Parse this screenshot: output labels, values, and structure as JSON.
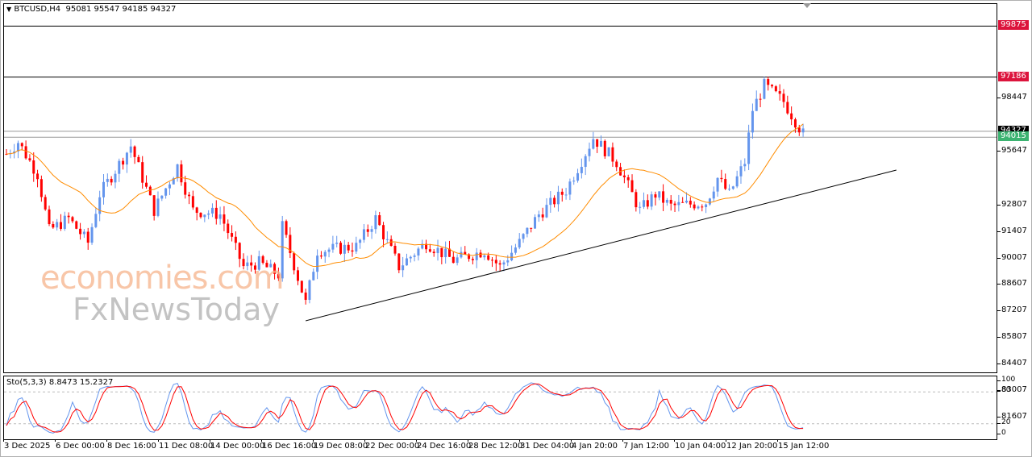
{
  "header": {
    "symbol": "BTCUSD,H4",
    "open": "95081",
    "high": "95547",
    "low": "94185",
    "close": "94327"
  },
  "indicator": {
    "label": "Sto(5,3,3)",
    "k": "8.8473",
    "d": "15.2327",
    "levels": [
      "100",
      "80",
      "20",
      "0"
    ]
  },
  "price_axis": [
    "98447",
    "95647",
    "92807",
    "91407",
    "90007",
    "88607",
    "87207",
    "85807",
    "84407",
    "83007",
    "81607"
  ],
  "price_labels": [
    {
      "value": "99875",
      "color": "#dc143c"
    },
    {
      "value": "97186",
      "color": "#dc143c"
    },
    {
      "value": "94327",
      "color": "#000000"
    },
    {
      "value": "94015",
      "color": "#3cb371"
    }
  ],
  "time_axis": [
    "3 Dec 2025",
    "6 Dec 00:00",
    "8 Dec 16:00",
    "11 Dec 08:00",
    "14 Dec 00:00",
    "16 Dec 16:00",
    "19 Dec 08:00",
    "22 Dec 00:00",
    "24 Dec 16:00",
    "28 Dec 12:00",
    "31 Dec 04:00",
    "4 Jan 20:00",
    "7 Jan 12:00",
    "10 Jan 04:00",
    "12 Jan 20:00",
    "15 Jan 12:00"
  ],
  "watermark": {
    "line1": "economies.com",
    "line2": "FxNewsToday"
  },
  "colors": {
    "bull": "#6495ed",
    "bear": "#ff0000",
    "ma": "#ff8c00",
    "k": "#6495ed",
    "d": "#ff0000"
  },
  "chart_data": {
    "type": "candlestick",
    "price_path": [
      [
        0,
        93133
      ],
      [
        3,
        93770
      ],
      [
        8,
        92070
      ],
      [
        11,
        89093
      ],
      [
        16,
        89730
      ],
      [
        21,
        88456
      ],
      [
        24,
        91006
      ],
      [
        32,
        93557
      ],
      [
        38,
        90156
      ],
      [
        44,
        92495
      ],
      [
        48,
        90156
      ],
      [
        55,
        89943
      ],
      [
        61,
        87180
      ],
      [
        65,
        87393
      ],
      [
        70,
        86755
      ],
      [
        71,
        89305
      ],
      [
        77,
        85267
      ],
      [
        80,
        88031
      ],
      [
        90,
        88243
      ],
      [
        95,
        89730
      ],
      [
        101,
        87180
      ],
      [
        108,
        88456
      ],
      [
        115,
        87520
      ],
      [
        123,
        88031
      ],
      [
        127,
        87180
      ],
      [
        132,
        88456
      ],
      [
        137,
        89943
      ],
      [
        144,
        91219
      ],
      [
        151,
        93983
      ],
      [
        157,
        92707
      ],
      [
        163,
        90156
      ],
      [
        167,
        91006
      ],
      [
        171,
        90369
      ],
      [
        180,
        90582
      ],
      [
        183,
        91857
      ],
      [
        186,
        91006
      ],
      [
        190,
        92707
      ],
      [
        192,
        95470
      ],
      [
        195,
        96746
      ],
      [
        200,
        95895
      ],
      [
        205,
        94195
      ]
    ],
    "trendline": [
      [
        77,
        84331
      ],
      [
        229,
        92281
      ]
    ],
    "hlines": [
      99875,
      97186,
      94327,
      94015
    ],
    "ma_period": 20
  }
}
